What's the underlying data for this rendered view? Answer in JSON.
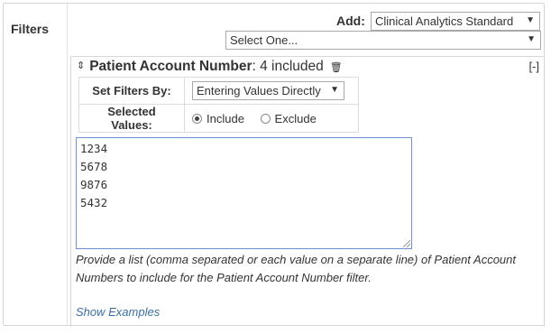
{
  "filters_label": "Filters",
  "add": {
    "label": "Add:",
    "selected": "Clinical Analytics Standard",
    "select_one": "Select One..."
  },
  "panel": {
    "title_name": "Patient Account Number",
    "title_count": ": 4 included",
    "collapse_label": "[-]",
    "set_filters_by_label": "Set Filters By:",
    "set_filters_by_value": "Entering Values Directly",
    "selected_values_label": "Selected Values:",
    "include_label": "Include",
    "exclude_label": "Exclude",
    "include_checked": true,
    "values": [
      "1234",
      "5678",
      "9876",
      "5432"
    ],
    "help_text": "Provide a list (comma separated or each value on a separate line) of Patient Account Numbers to include for the Patient Account Number filter.",
    "show_examples_label": "Show Examples"
  },
  "icons": {
    "sort": "sort-icon",
    "trash": "trash-icon",
    "dropdown": "chevron-down-icon"
  }
}
